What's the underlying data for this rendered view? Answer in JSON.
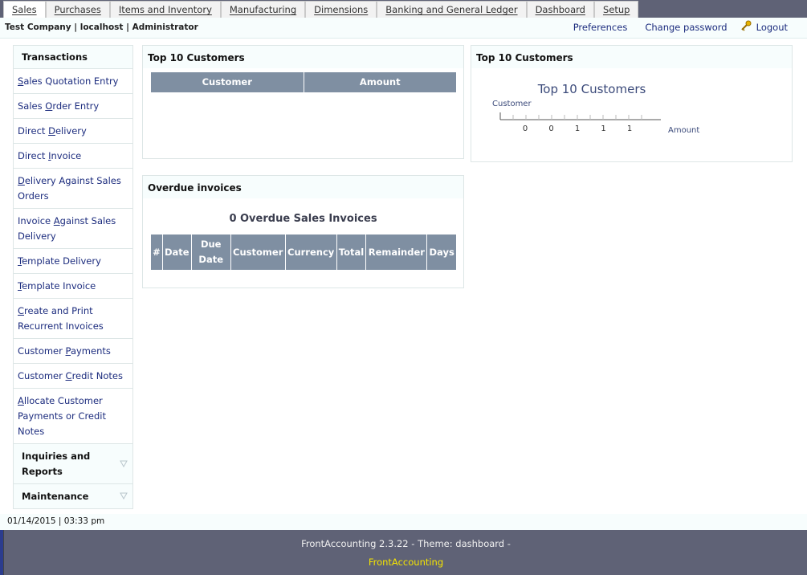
{
  "tabs": [
    {
      "label": "Sales",
      "active": true
    },
    {
      "label": "Purchases"
    },
    {
      "label": "Items and Inventory"
    },
    {
      "label": "Manufacturing"
    },
    {
      "label": "Dimensions"
    },
    {
      "label": "Banking and General Ledger"
    },
    {
      "label": "Dashboard"
    },
    {
      "label": "Setup"
    }
  ],
  "userbar": {
    "company": "Test Company | localhost | Administrator",
    "preferences": "Preferences",
    "change_password": "Change password",
    "logout": "Logout"
  },
  "leftmenu": {
    "heading": "Transactions",
    "items": [
      "Sales Quotation Entry",
      "Sales Order Entry",
      "Direct Delivery",
      "Direct Invoice",
      "Delivery Against Sales Orders",
      "Invoice Against Sales Delivery",
      "Template Delivery",
      "Template Invoice",
      "Create and Print Recurrent Invoices",
      "Customer Payments",
      "Customer Credit Notes",
      "Allocate Customer Payments or Credit Notes"
    ],
    "groups": [
      "Inquiries and Reports",
      "Maintenance"
    ]
  },
  "top_customers_table": {
    "title": "Top 10 Customers",
    "columns": [
      "Customer",
      "Amount"
    ]
  },
  "top_customers_chart": {
    "title": "Top 10 Customers"
  },
  "chart_data": {
    "type": "bar",
    "title": "Top 10 Customers",
    "ylabel": "Customer",
    "xlabel": "Amount",
    "categories": [],
    "values": [],
    "x_ticks": [
      "0",
      "0",
      "1",
      "1",
      "1"
    ]
  },
  "overdue": {
    "title": "Overdue invoices",
    "count_text": "0 Overdue Sales Invoices",
    "columns": [
      "#",
      "Date",
      "Due Date",
      "Customer",
      "Currency",
      "Total",
      "Remainder",
      "Days"
    ]
  },
  "status": {
    "datetime": "01/14/2015 | 03:33 pm"
  },
  "footer": {
    "version": "FrontAccounting 2.3.22 - Theme: dashboard -",
    "link": "FrontAccounting"
  },
  "colors": {
    "topbar": "#5f6276",
    "header_cell": "#7f8fa2",
    "link": "#1c2c7e",
    "footer_link": "#f6e500"
  }
}
